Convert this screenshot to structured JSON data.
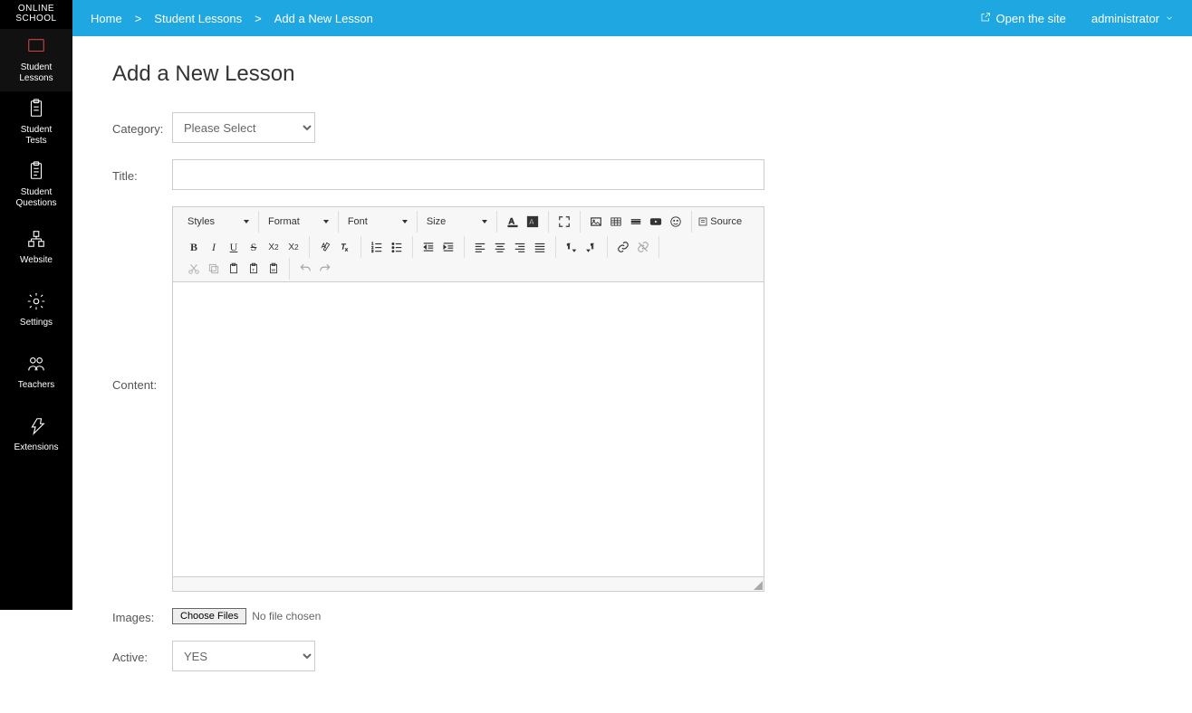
{
  "logo": {
    "line1": "ONLINE",
    "line2": "SCHOOL"
  },
  "sidebar": [
    {
      "label": "Student\nLessons",
      "icon": "lessons"
    },
    {
      "label": "Student\nTests",
      "icon": "tests"
    },
    {
      "label": "Student\nQuestions",
      "icon": "questions"
    },
    {
      "label": "Website",
      "icon": "website"
    },
    {
      "label": "Settings",
      "icon": "settings"
    },
    {
      "label": "Teachers",
      "icon": "teachers"
    },
    {
      "label": "Extensions",
      "icon": "extensions"
    }
  ],
  "breadcrumb": [
    {
      "label": "Home"
    },
    {
      "label": "Student Lessons"
    },
    {
      "label": "Add a New Lesson"
    }
  ],
  "topbar": {
    "open_site": "Open the site",
    "user": "administrator"
  },
  "page_title": "Add a New Lesson",
  "form": {
    "category_label": "Category:",
    "category_placeholder": "Please Select",
    "title_label": "Title:",
    "title_value": "",
    "content_label": "Content:",
    "images_label": "Images:",
    "choose_files": "Choose Files",
    "file_status": "No file chosen",
    "active_label": "Active:",
    "active_value": "YES"
  },
  "editor": {
    "combos": {
      "styles": "Styles",
      "format": "Format",
      "font": "Font",
      "size": "Size"
    },
    "source": "Source"
  }
}
